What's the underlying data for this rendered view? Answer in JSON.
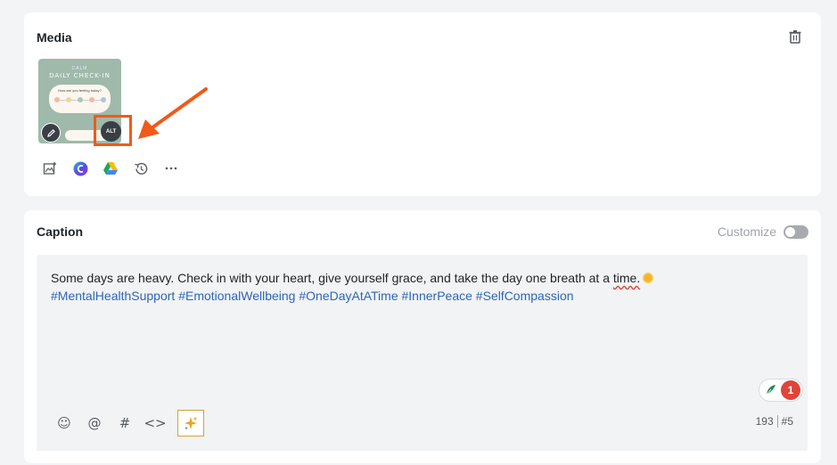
{
  "media": {
    "title": "Media",
    "thumbnail": {
      "brand_text": "CALM",
      "heading": "DAILY CHECK-IN",
      "question": "How are you feeling today?"
    },
    "alt_label": "ALT",
    "tools": [
      "add-image-icon",
      "canva-icon",
      "google-drive-icon",
      "history-icon",
      "more-icon"
    ]
  },
  "caption": {
    "title": "Caption",
    "customize_label": "Customize",
    "customize_enabled": false,
    "text_main": "Some days are heavy. Check in with your heart, give yourself grace, and take the day one breath at a ",
    "text_error_word": "time.",
    "hashtags": "#MentalHealthSupport #EmotionalWellbeing #OneDayAtATime #InnerPeace #SelfCompassion",
    "grammar_issue_count": "1",
    "char_count": "193",
    "hashtag_count": "#5",
    "tool_symbols": {
      "emoji": "☺",
      "mention": "@",
      "hashtag": "#",
      "code": "<>"
    }
  },
  "colors": {
    "accent_orange": "#f05a1a",
    "hashtag_blue": "#2e66b8",
    "error_red": "#e0443a",
    "ai_gold": "#d2a338"
  }
}
